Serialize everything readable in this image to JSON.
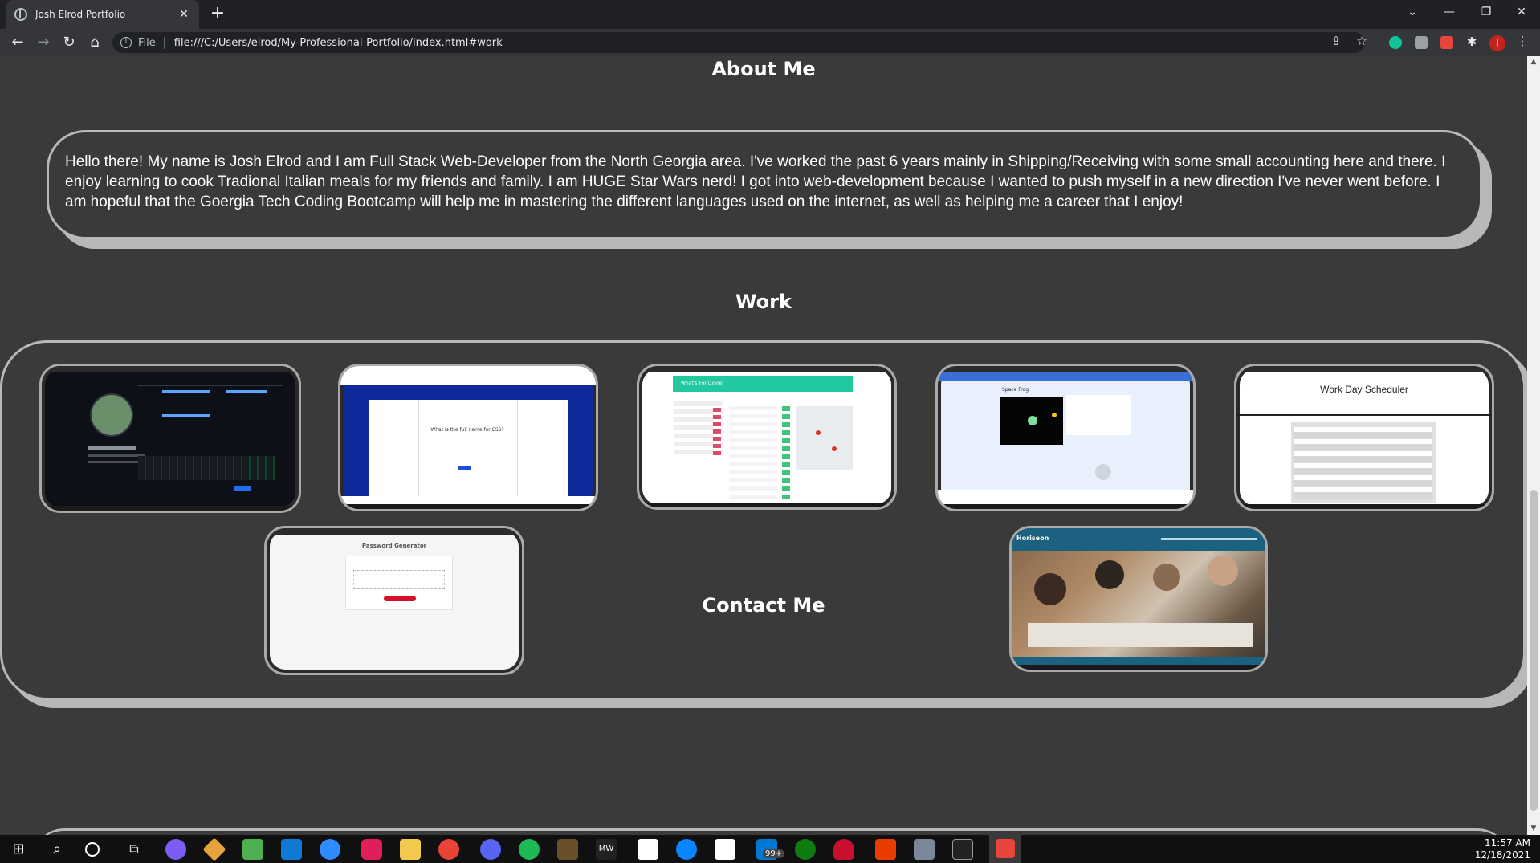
{
  "browser": {
    "tab_title": "Josh Elrod Portfolio",
    "new_tab": "+",
    "scheme": "File",
    "url": "file:///C:/Users/elrod/My-Professional-Portfolio/index.html#work",
    "profile_initial": "J"
  },
  "page": {
    "about": {
      "heading": "About Me",
      "text": "Hello there! My name is Josh Elrod and I am Full Stack Web-Developer from the North Georgia area. I've worked the past 6 years mainly in Shipping/Receiving with some small accounting here and there. I enjoy learning to cook Tradional Italian meals for my friends and family. I am HUGE Star Wars nerd! I got into web-development because I wanted to push myself in a new direction I've never went before. I am hopeful that the Goergia Tech Coding Bootcamp will help me in mastering the different languages used on the internet, as well as helping me a career that I enjoy!"
    },
    "work": {
      "heading": "Work",
      "projects": [
        {
          "label": ""
        },
        {
          "label": "What is the full name for CSS?"
        },
        {
          "label": "What's For Dinner"
        },
        {
          "label": "Space Frog"
        },
        {
          "label": "Work Day Scheduler"
        },
        {
          "label": "Password Generator"
        },
        {
          "label": "Horiseon"
        }
      ]
    },
    "contact": {
      "heading": "Contact Me"
    }
  },
  "taskbar": {
    "time": "11:57 AM",
    "date": "12/18/2021",
    "badge": "99+"
  },
  "colors": {
    "page_bg": "#3a3a3a",
    "border": "#b8b8b8",
    "chrome_dark": "#202124",
    "chrome_mid": "#35363a"
  }
}
